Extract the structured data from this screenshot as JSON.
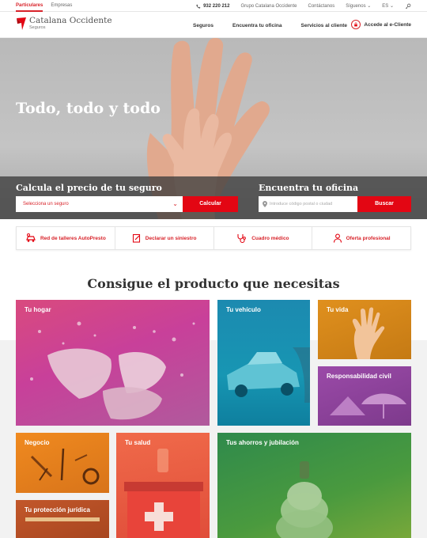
{
  "topbar": {
    "left_tabs": [
      "Particulares",
      "Empresas"
    ],
    "phone": "932 220 212",
    "links": [
      "Grupo Catalana Occidente",
      "Contáctanos"
    ],
    "follow": "Síguenos",
    "lang": "ES"
  },
  "brand": {
    "name": "Catalana Occidente",
    "sub": "Seguros"
  },
  "nav": [
    "Seguros",
    "Encuentra tu oficina",
    "Servicios al cliente"
  ],
  "ecliente": "Accede al e-Cliente",
  "hero": {
    "title": "Todo, todo y todo"
  },
  "quote": {
    "label": "Calcula el precio de tu seguro",
    "select_value": "Selecciona un seguro",
    "button": "Calcular"
  },
  "office": {
    "label": "Encuentra tu oficina",
    "placeholder": "Introduce código postal o ciudad",
    "button": "Buscar"
  },
  "quick_links": [
    "Red de talleres AutoPresto",
    "Declarar un siniestro",
    "Cuadro médico",
    "Oferta profesional"
  ],
  "section_title": "Consigue el producto que necesitas",
  "tiles": {
    "hogar": "Tu hogar",
    "vehiculo": "Tu vehículo",
    "vida": "Tu vida",
    "responsabilidad": "Responsabilidad civil",
    "negocio": "Negocio",
    "salud": "Tu salud",
    "ahorros": "Tus ahorros y jubilación",
    "juridica": "Tu protección jurídica"
  },
  "colors": {
    "brand_red": "#e30613"
  }
}
